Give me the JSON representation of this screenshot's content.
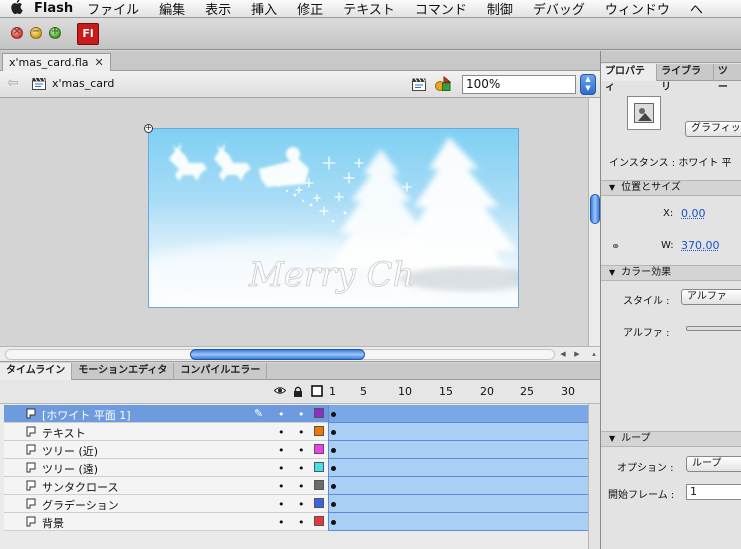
{
  "menubar": {
    "apple": "",
    "app_name": "Flash",
    "items": [
      "ファイル",
      "編集",
      "表示",
      "挿入",
      "修正",
      "テキスト",
      "コマンド",
      "制御",
      "デバッグ",
      "ウィンドウ",
      "ヘ"
    ]
  },
  "toolbar": {
    "logo": "Fl"
  },
  "document": {
    "tab_title": "x'mas_card.fla",
    "tab_close": "✕",
    "scene_name": "x'mas_card",
    "zoom": "100%"
  },
  "stage": {
    "text": "Merry Ch"
  },
  "panel_tabs": [
    "タイムライン",
    "モーションエディタ",
    "コンパイルエラー"
  ],
  "timeline": {
    "frame_numbers": [
      "1",
      "5",
      "10",
      "15",
      "20",
      "25",
      "30"
    ],
    "layers": [
      {
        "name": "[ホワイト 平面 1]",
        "color": "#8e2ccf",
        "selected": true
      },
      {
        "name": "テキスト",
        "color": "#f07800",
        "selected": false
      },
      {
        "name": "ツリー (近)",
        "color": "#ef3de9",
        "selected": false
      },
      {
        "name": "ツリー (遠)",
        "color": "#3ee2e8",
        "selected": false
      },
      {
        "name": "サンタクロース",
        "color": "#6b6b6b",
        "selected": false
      },
      {
        "name": "グラデーション",
        "color": "#3c64e0",
        "selected": false
      },
      {
        "name": "背景",
        "color": "#e8353a",
        "selected": false
      }
    ]
  },
  "properties": {
    "tabs": [
      "プロパティ",
      "ライブラリ",
      "ツー"
    ],
    "graphic_dropdown": "グラフィッ",
    "instance_label": "インスタンス : ホワイト 平",
    "position_size": {
      "title": "位置とサイズ",
      "x_label": "X:",
      "x_value": "0.00",
      "w_label": "W:",
      "w_value": "370.00"
    },
    "color_effect": {
      "title": "カラー効果",
      "style_label": "スタイル :",
      "style_value": "アルファ",
      "alpha_label": "アルファ :"
    },
    "loop": {
      "title": "ループ",
      "option_label": "オプション :",
      "option_value": "ループ",
      "first_frame_label": "開始フレーム :",
      "first_frame_value": "1"
    }
  }
}
